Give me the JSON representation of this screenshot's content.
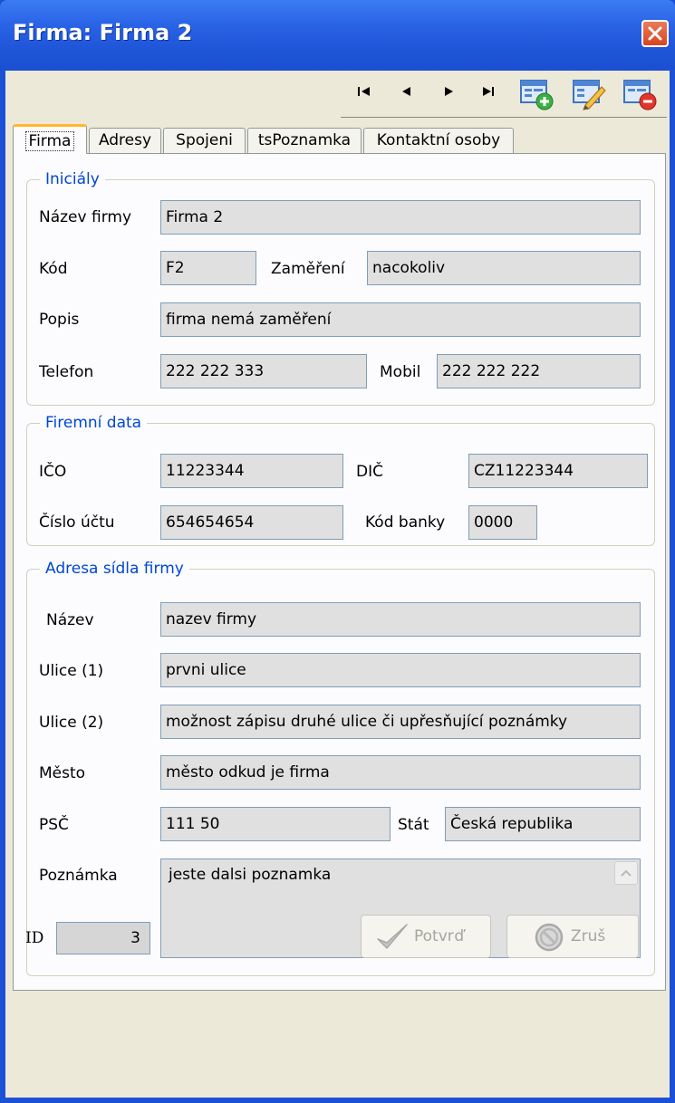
{
  "window": {
    "title": "Firma: Firma 2"
  },
  "tabs": [
    {
      "label": "Firma"
    },
    {
      "label": "Adresy"
    },
    {
      "label": "Spojeni"
    },
    {
      "label": "tsPoznamka"
    },
    {
      "label": "Kontaktní osoby"
    }
  ],
  "groups": {
    "inicialy": "Iniciály",
    "firemni_data": "Firemní data",
    "adresa": "Adresa sídla firmy"
  },
  "form": {
    "nazev_firmy": {
      "label": "Název firmy",
      "value": "Firma 2"
    },
    "kod": {
      "label": "Kód",
      "value": "F2"
    },
    "zamereni": {
      "label": "Zaměření",
      "value": "nacokoliv"
    },
    "popis": {
      "label": "Popis",
      "value": "firma nemá zaměření"
    },
    "telefon": {
      "label": "Telefon",
      "value": "222 222 333"
    },
    "mobil": {
      "label": "Mobil",
      "value": "222 222 222"
    },
    "ico": {
      "label": "IČO",
      "value": "11223344"
    },
    "dic": {
      "label": "DIČ",
      "value": "CZ11223344"
    },
    "cislo_uctu": {
      "label": "Číslo účtu",
      "value": "654654654"
    },
    "kod_banky": {
      "label": "Kód banky",
      "value": "0000"
    },
    "nazev": {
      "label": "Název",
      "value": "nazev firmy"
    },
    "ulice1": {
      "label": "Ulice (1)",
      "value": "prvni ulice"
    },
    "ulice2": {
      "label": "Ulice (2)",
      "value": "možnost zápisu druhé ulice či upřesňující poznámky"
    },
    "mesto": {
      "label": "Město",
      "value": "město odkud je firma"
    },
    "psc": {
      "label": "PSČ",
      "value": "111 50"
    },
    "stat": {
      "label": "Stát",
      "value": "Česká republika"
    },
    "poznamka": {
      "label": "Poznámka",
      "value": "jeste dalsi poznamka"
    }
  },
  "footer": {
    "id_label": "ID",
    "id_value": "3",
    "confirm_label": "Potvrď",
    "cancel_label": "Zruš"
  },
  "icons": {
    "nav": [
      "first-record-icon",
      "previous-record-icon",
      "next-record-icon",
      "last-record-icon"
    ],
    "toolbar": [
      "add-record-icon",
      "edit-record-icon",
      "delete-record-icon"
    ]
  },
  "colors": {
    "titlebar": "#2a63e6",
    "group_legend": "#0046d5",
    "active_tab_accent": "#ffb72e",
    "field_bg": "#e0e0e0"
  }
}
